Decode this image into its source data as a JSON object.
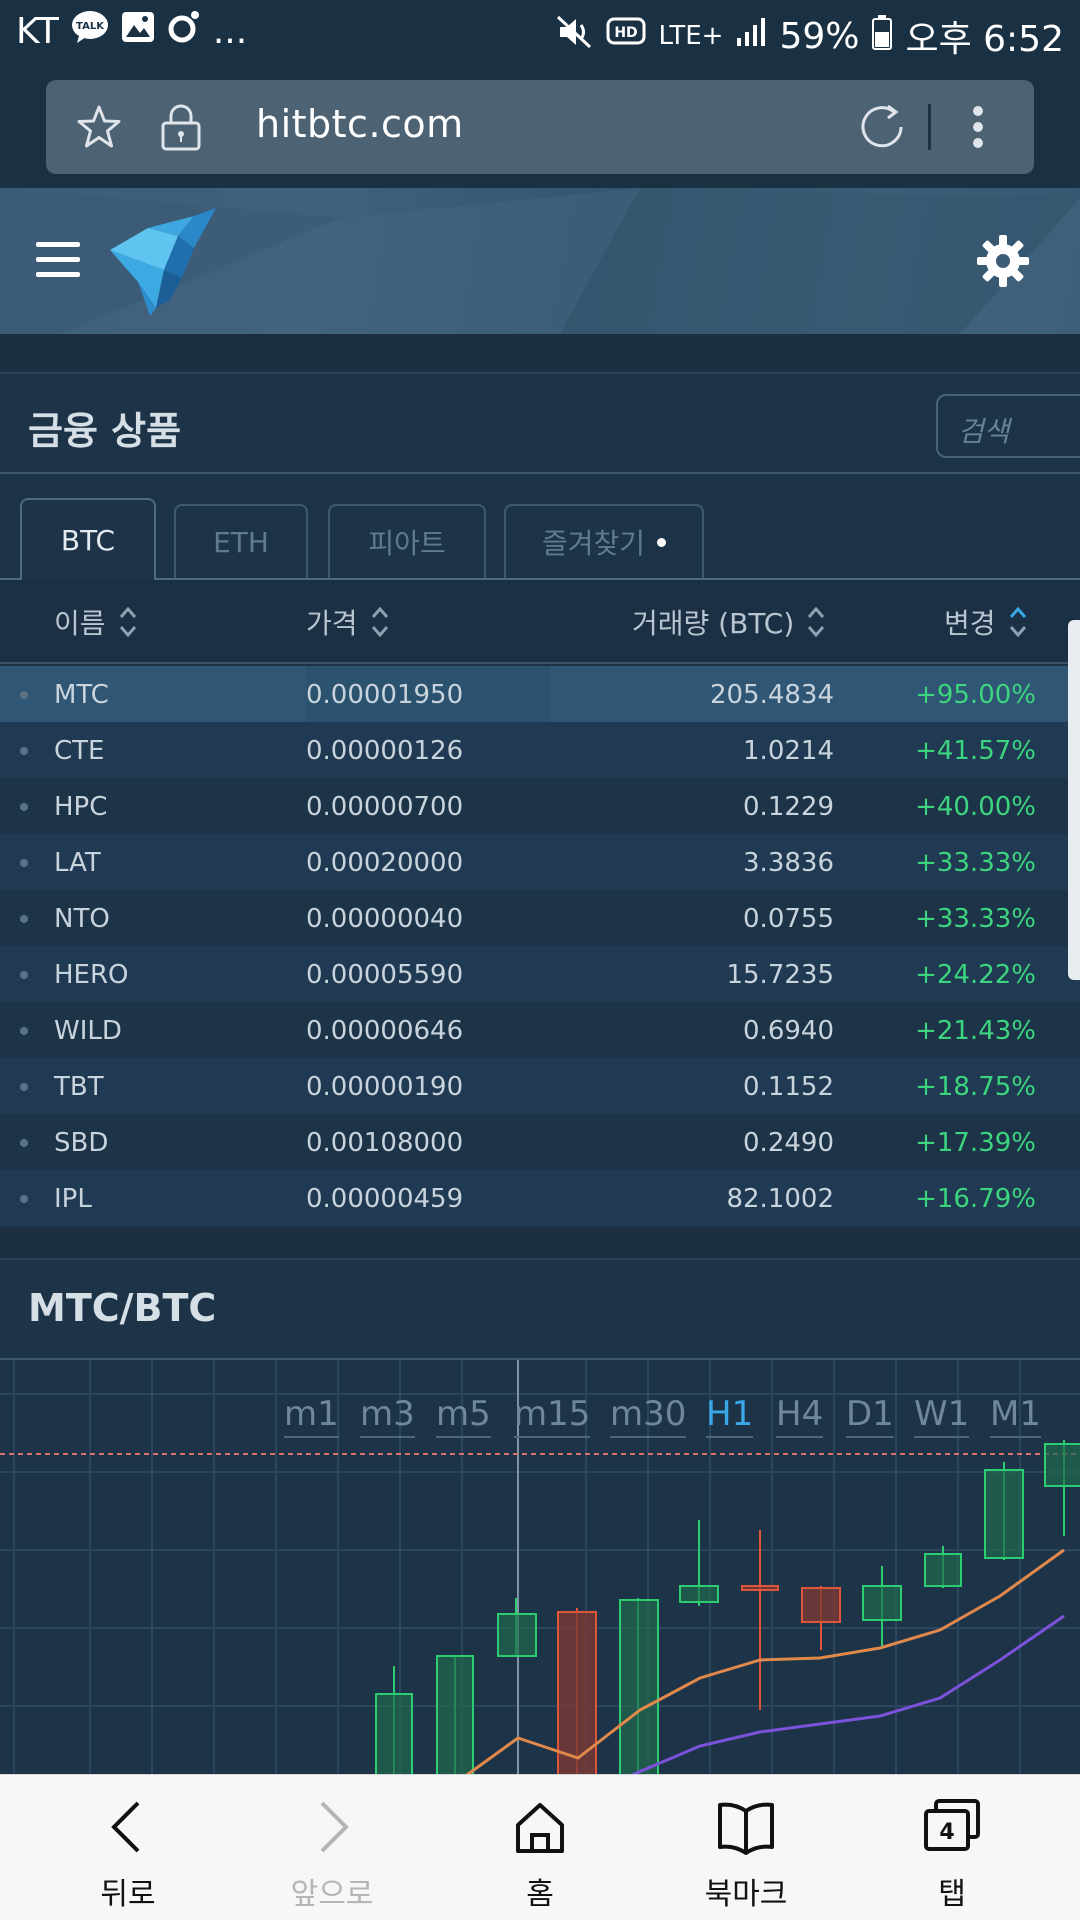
{
  "status_bar": {
    "carrier": "KT",
    "more": "...",
    "network": "LTE+",
    "battery": "59%",
    "time": "오후 6:52"
  },
  "browser": {
    "url": "hitbtc.com"
  },
  "market": {
    "title": "금융 상품",
    "search_placeholder": "검색",
    "tabs": [
      {
        "label": "BTC",
        "active": true
      },
      {
        "label": "ETH",
        "active": false
      },
      {
        "label": "피아트",
        "active": false
      },
      {
        "label": "즐겨찾기",
        "active": false
      }
    ],
    "columns": {
      "name": "이름",
      "price": "가격",
      "volume": "거래량 (BTC)",
      "change": "변경"
    },
    "rows": [
      {
        "name": "MTC",
        "price": "0.00001950",
        "volume": "205.4834",
        "change": "+95.00%"
      },
      {
        "name": "CTE",
        "price": "0.00000126",
        "volume": "1.0214",
        "change": "+41.57%"
      },
      {
        "name": "HPC",
        "price": "0.00000700",
        "volume": "0.1229",
        "change": "+40.00%"
      },
      {
        "name": "LAT",
        "price": "0.00020000",
        "volume": "3.3836",
        "change": "+33.33%"
      },
      {
        "name": "NTO",
        "price": "0.00000040",
        "volume": "0.0755",
        "change": "+33.33%"
      },
      {
        "name": "HERO",
        "price": "0.00005590",
        "volume": "15.7235",
        "change": "+24.22%"
      },
      {
        "name": "WILD",
        "price": "0.00000646",
        "volume": "0.6940",
        "change": "+21.43%"
      },
      {
        "name": "TBT",
        "price": "0.00000190",
        "volume": "0.1152",
        "change": "+18.75%"
      },
      {
        "name": "SBD",
        "price": "0.00108000",
        "volume": "0.2490",
        "change": "+17.39%"
      },
      {
        "name": "IPL",
        "price": "0.00000459",
        "volume": "82.1002",
        "change": "+16.79%"
      }
    ],
    "colors": {
      "positive": "#3dd47f",
      "selected_row": "#2f5675"
    }
  },
  "chart": {
    "title": "MTC/BTC",
    "timeframes": [
      "m1",
      "m3",
      "m5",
      "m15",
      "m30",
      "H1",
      "H4",
      "D1",
      "W1",
      "M1"
    ],
    "active_timeframe": "H1",
    "colors": {
      "up": "#2ecc71",
      "down": "#e0553a",
      "ma_fast": "#e0894a",
      "ma_slow": "#7b52d9",
      "price_line": "#d9736a"
    }
  },
  "bottom_nav": {
    "back": "뒤로",
    "forward": "앞으로",
    "home": "홈",
    "bookmarks": "북마크",
    "tabs": "탭",
    "tab_count": "4"
  }
}
